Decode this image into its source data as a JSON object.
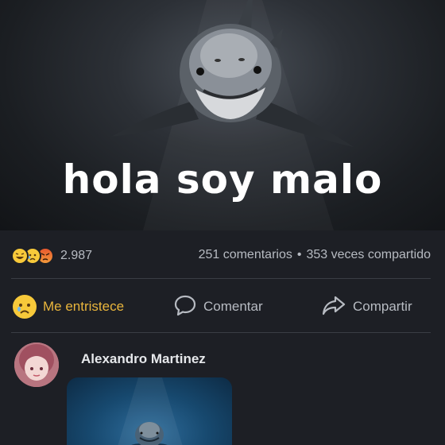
{
  "post": {
    "caption": "hola soy malo"
  },
  "stats": {
    "reaction_icons": [
      "laughing-emoji",
      "sad-emoji",
      "angry-emoji"
    ],
    "reaction_count": "2.987",
    "comments": "251 comentarios",
    "separator": "•",
    "shares": "353 veces compartido"
  },
  "actions": {
    "reaction_label": "Me entristece",
    "comment_label": "Comentar",
    "share_label": "Compartir"
  },
  "comment": {
    "author": "Alexandro Martinez"
  },
  "colors": {
    "background": "#1d1f25",
    "sad_reaction_accent": "#e9b53c",
    "text_secondary": "#b7bbc2",
    "author_text": "#e6e8eb"
  }
}
